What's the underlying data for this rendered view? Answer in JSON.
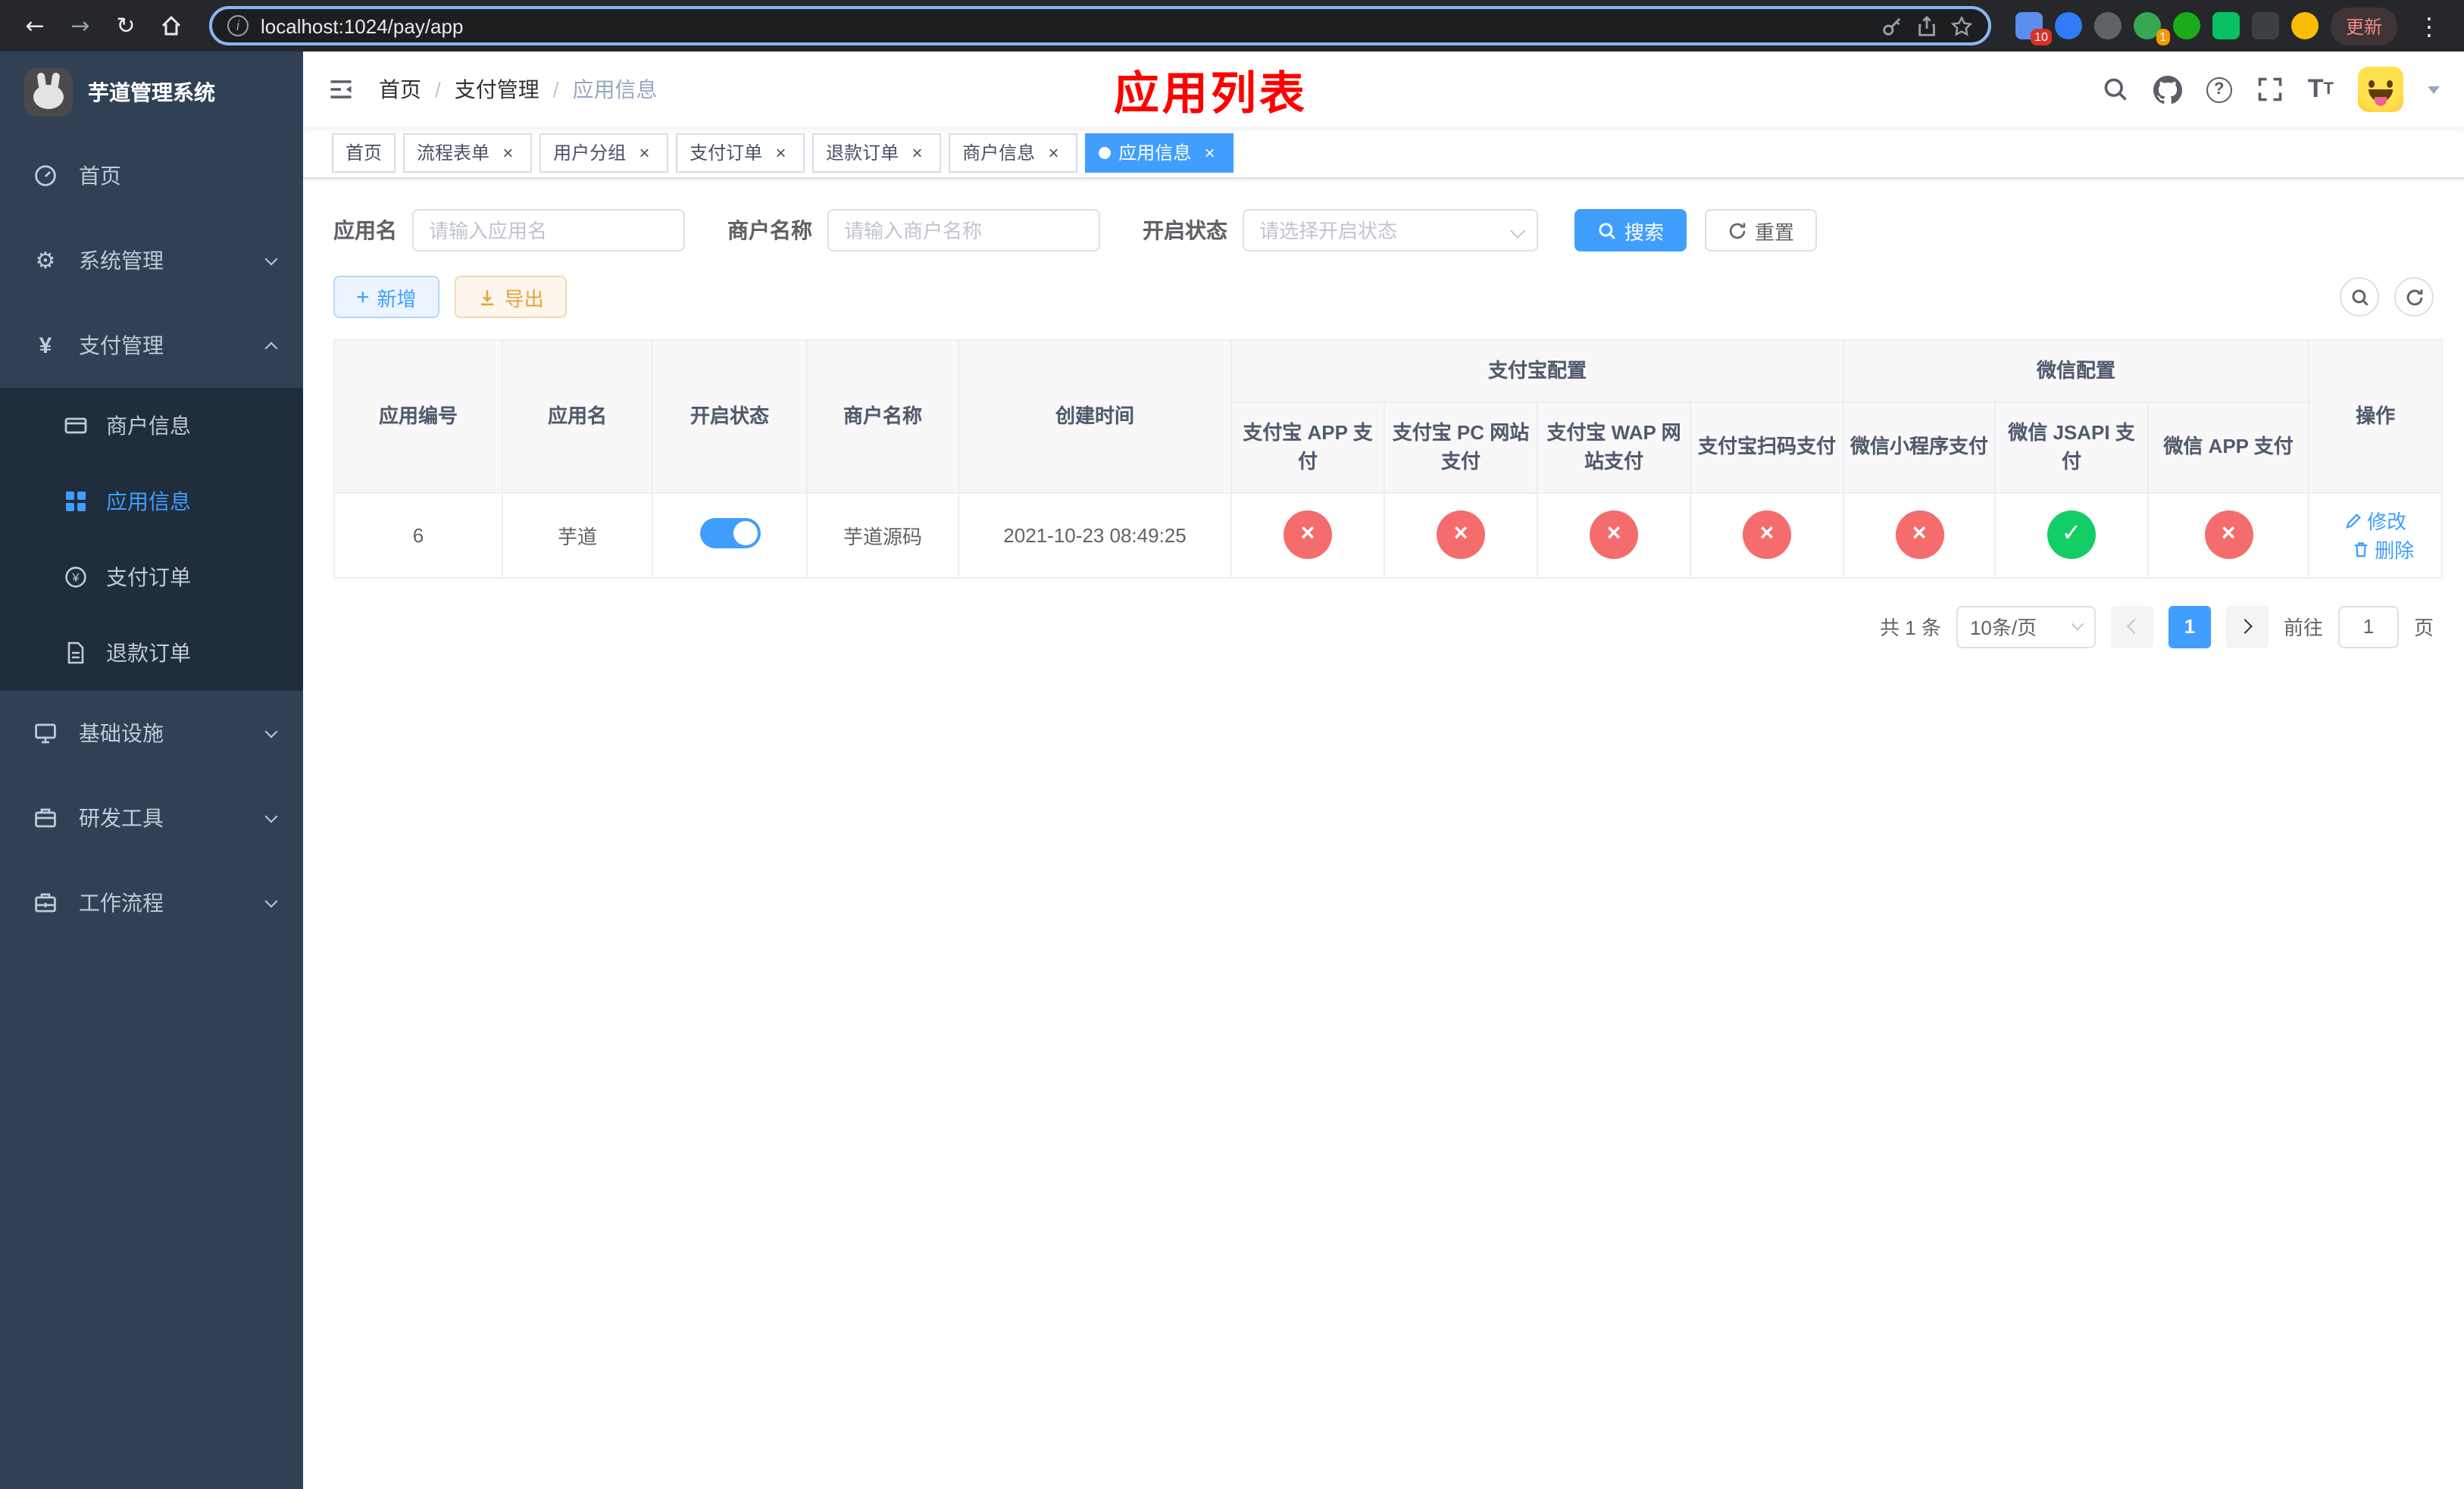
{
  "colors": {
    "accent": "#409eff",
    "danger": "#f56c6c",
    "success": "#13ce66",
    "warning": "#e6a23c",
    "sidebar_bg": "#304156",
    "page_title_red": "#ff0000"
  },
  "browser": {
    "url": "localhost:1024/pay/app",
    "update_label": "更新",
    "extension_badges": {
      "pinned": "10",
      "profile": "1"
    }
  },
  "sidebar": {
    "logo_title": "芋道管理系统",
    "menu": [
      {
        "label": "首页"
      },
      {
        "label": "系统管理"
      },
      {
        "label": "支付管理"
      },
      {
        "label": "基础设施"
      },
      {
        "label": "研发工具"
      },
      {
        "label": "工作流程"
      }
    ],
    "pay_submenu": [
      {
        "label": "商户信息"
      },
      {
        "label": "应用信息"
      },
      {
        "label": "支付订单"
      },
      {
        "label": "退款订单"
      }
    ]
  },
  "header": {
    "breadcrumb": [
      "首页",
      "支付管理",
      "应用信息"
    ],
    "page_title": "应用列表"
  },
  "tabs": [
    {
      "label": "首页"
    },
    {
      "label": "流程表单"
    },
    {
      "label": "用户分组"
    },
    {
      "label": "支付订单"
    },
    {
      "label": "退款订单"
    },
    {
      "label": "商户信息"
    },
    {
      "label": "应用信息"
    }
  ],
  "filters": {
    "app_name_label": "应用名",
    "app_name_placeholder": "请输入应用名",
    "merchant_label": "商户名称",
    "merchant_placeholder": "请输入商户名称",
    "status_label": "开启状态",
    "status_placeholder": "请选择开启状态",
    "search_label": "搜索",
    "reset_label": "重置"
  },
  "toolbar": {
    "add_label": "新增",
    "export_label": "导出"
  },
  "table": {
    "columns": [
      "应用编号",
      "应用名",
      "开启状态",
      "商户名称",
      "创建时间"
    ],
    "groups": [
      {
        "label": "支付宝配置",
        "columns": [
          "支付宝 APP 支付",
          "支付宝 PC 网站支付",
          "支付宝 WAP 网站支付",
          "支付宝扫码支付"
        ]
      },
      {
        "label": "微信配置",
        "columns": [
          "微信小程序支付",
          "微信 JSAPI 支付",
          "微信 APP 支付"
        ]
      }
    ],
    "action_column": "操作",
    "rows": [
      {
        "id": "6",
        "name": "芋道",
        "status_on": true,
        "merchant": "芋道源码",
        "created": "2021-10-23 08:49:25",
        "configs": [
          false,
          false,
          false,
          false,
          false,
          true,
          false
        ],
        "edit_label": "修改",
        "delete_label": "删除"
      }
    ]
  },
  "pagination": {
    "total_text": "共 1 条",
    "page_size": "10条/页",
    "current_page": "1",
    "goto_label": "前往",
    "goto_value": "1",
    "goto_suffix": "页"
  }
}
